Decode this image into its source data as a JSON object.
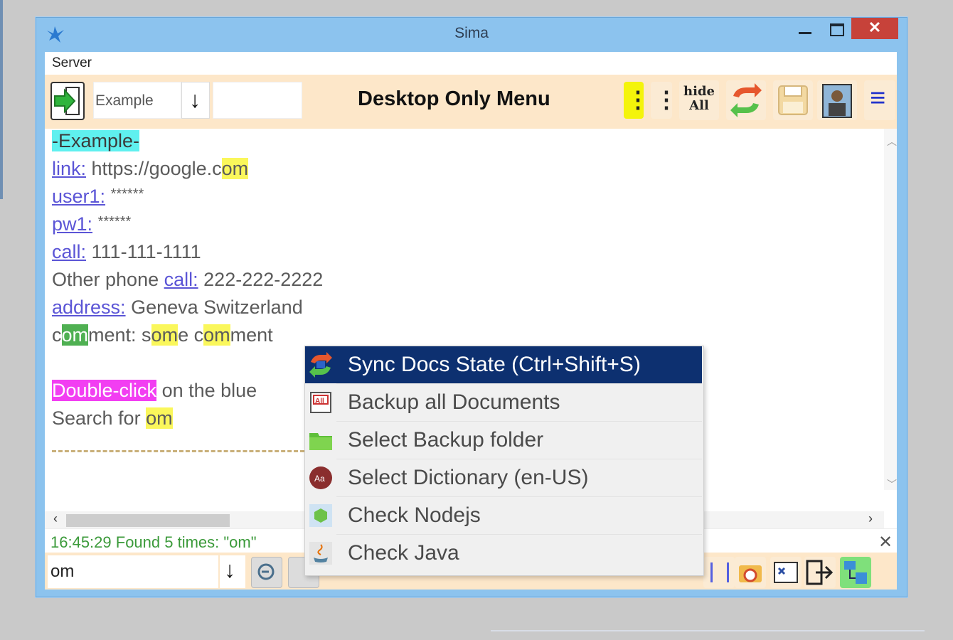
{
  "window": {
    "title": "Sima",
    "close_glyph": "✕"
  },
  "menubar": {
    "server": "Server"
  },
  "toolbar": {
    "combo_value": "Example",
    "combo_arrow": "↓",
    "title": "Desktop Only Menu",
    "dots": "⋮",
    "hide_all_line1": "hide",
    "hide_all_line2": "All",
    "menu_glyph": "≡",
    "icons": [
      "login-icon",
      "sync-icon",
      "save-icon",
      "user-card-icon",
      "hamburger-menu-icon"
    ]
  },
  "content": {
    "heading": "-Example-",
    "link_label": "link:",
    "link_value_pre": "https://google.c",
    "link_value_hl": "om",
    "user_label": "user1:",
    "user_value": "******",
    "pw_label": "pw1:",
    "pw_value": "******",
    "call_label": "call:",
    "call_value": "111-111-1111",
    "other_phone_pre": "Other phone ",
    "other_phone_label": "call:",
    "other_phone_value": "222-222-2222",
    "address_label": "address:",
    "address_value": "Geneva Switzerland",
    "comment_c": "c",
    "comment_om1": "om",
    "comment_ment": "ment: s",
    "comment_om2": "om",
    "comment_e": "e c",
    "comment_om3": "om",
    "comment_end": "ment",
    "dbl_click": "Double-click",
    "dbl_rest": " on the blue",
    "search_pre": "Search for ",
    "search_term": "om"
  },
  "status": {
    "text": "16:45:29  Found 5 times: \"om\"",
    "close": "✕"
  },
  "search": {
    "value": "om",
    "arrow": "↓"
  },
  "context_menu": {
    "items": [
      {
        "label": "Sync Docs State (Ctrl+Shift+S)",
        "icon": "sync-icon",
        "active": true
      },
      {
        "label": "Backup all Documents",
        "icon": "backup-all-icon",
        "active": false
      },
      {
        "label": "Select Backup folder",
        "icon": "folder-icon",
        "active": false
      },
      {
        "label": "Select Dictionary (en-US)",
        "icon": "dictionary-icon",
        "active": false
      },
      {
        "label": "Check Nodejs",
        "icon": "nodejs-icon",
        "active": false
      },
      {
        "label": "Check Java",
        "icon": "java-icon",
        "active": false
      }
    ]
  },
  "colors": {
    "toolbar_bg": "#fde7c9",
    "menu_highlight": "#0d3070",
    "status_green": "#3b9a3a",
    "link_blue": "#5b55d6",
    "window_frame": "#8cc3ee"
  }
}
